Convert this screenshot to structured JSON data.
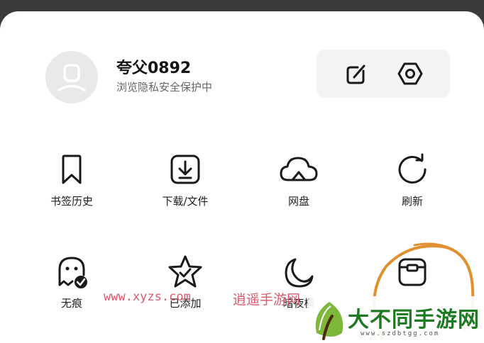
{
  "profile": {
    "username": "夸父0892",
    "subtitle": "浏览隐私安全保护中"
  },
  "toolbar": {
    "icons": [
      "edit-icon",
      "settings-hexagon-icon"
    ]
  },
  "menu": {
    "row1": [
      {
        "label": "书签历史",
        "icon": "bookmark-icon"
      },
      {
        "label": "下载/文件",
        "icon": "download-icon"
      },
      {
        "label": "网盘",
        "icon": "cloud-icon"
      },
      {
        "label": "刷新",
        "icon": "refresh-icon"
      }
    ],
    "row2": [
      {
        "label": "无痕",
        "icon": "ghost-icon"
      },
      {
        "label": "已添加",
        "icon": "star-icon"
      },
      {
        "label": "暗夜模",
        "icon": "moon-icon"
      },
      {
        "label": "",
        "icon": "toolbox-icon"
      }
    ]
  },
  "watermark": {
    "url": "www.xyzs.com",
    "text": "逍遥手游网"
  },
  "logo": {
    "text": "大不同手游网",
    "domain": "www.szdbtgg.com"
  },
  "colors": {
    "annotation_circle": "#e0902f",
    "watermark": "#d95a6e",
    "logo_green": "#1e7a22"
  }
}
